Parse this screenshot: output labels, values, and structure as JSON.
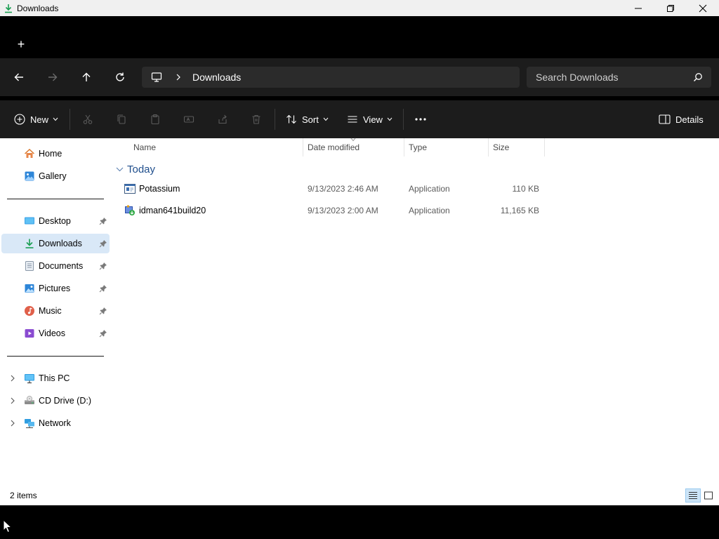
{
  "window": {
    "title": "Downloads",
    "controls": [
      "minimize-icon",
      "restore-icon",
      "close-icon"
    ]
  },
  "tabs": {
    "new_tab_label": "+"
  },
  "navigation": {
    "back": "back-arrow-icon",
    "forward": "forward-arrow-icon",
    "up": "up-arrow-icon",
    "refresh": "refresh-icon",
    "breadcrumb": [
      "Downloads"
    ],
    "search_placeholder": "Search Downloads"
  },
  "command_bar": {
    "new_label": "New",
    "sort_label": "Sort",
    "view_label": "View",
    "details_label": "Details",
    "disabled_actions": [
      "cut-icon",
      "copy-icon",
      "paste-icon",
      "rename-icon",
      "share-icon",
      "delete-icon"
    ]
  },
  "sidebar": {
    "quick": [
      {
        "label": "Home",
        "icon": "home-icon"
      },
      {
        "label": "Gallery",
        "icon": "gallery-icon"
      }
    ],
    "pinned": [
      {
        "label": "Desktop",
        "icon": "desktop-icon"
      },
      {
        "label": "Downloads",
        "icon": "downloads-icon",
        "selected": true
      },
      {
        "label": "Documents",
        "icon": "documents-icon"
      },
      {
        "label": "Pictures",
        "icon": "pictures-icon"
      },
      {
        "label": "Music",
        "icon": "music-icon"
      },
      {
        "label": "Videos",
        "icon": "videos-icon"
      }
    ],
    "locations": [
      {
        "label": "This PC",
        "icon": "this-pc-icon"
      },
      {
        "label": "CD Drive (D:)",
        "icon": "cd-drive-icon"
      },
      {
        "label": "Network",
        "icon": "network-icon"
      }
    ]
  },
  "file_list": {
    "columns": [
      "Name",
      "Date modified",
      "Type",
      "Size"
    ],
    "group": "Today",
    "rows": [
      {
        "name": "Potassium",
        "date": "9/13/2023 2:46 AM",
        "type": "Application",
        "size": "110 KB",
        "icon": "application-icon"
      },
      {
        "name": "idman641build20",
        "date": "9/13/2023 2:00 AM",
        "type": "Application",
        "size": "11,165 KB",
        "icon": "installer-icon"
      }
    ]
  },
  "status": {
    "item_count": "2 items"
  },
  "colors": {
    "accent": "#0067c0",
    "selected_bg": "#d9e8f7",
    "group_header": "#1f4e8c"
  }
}
